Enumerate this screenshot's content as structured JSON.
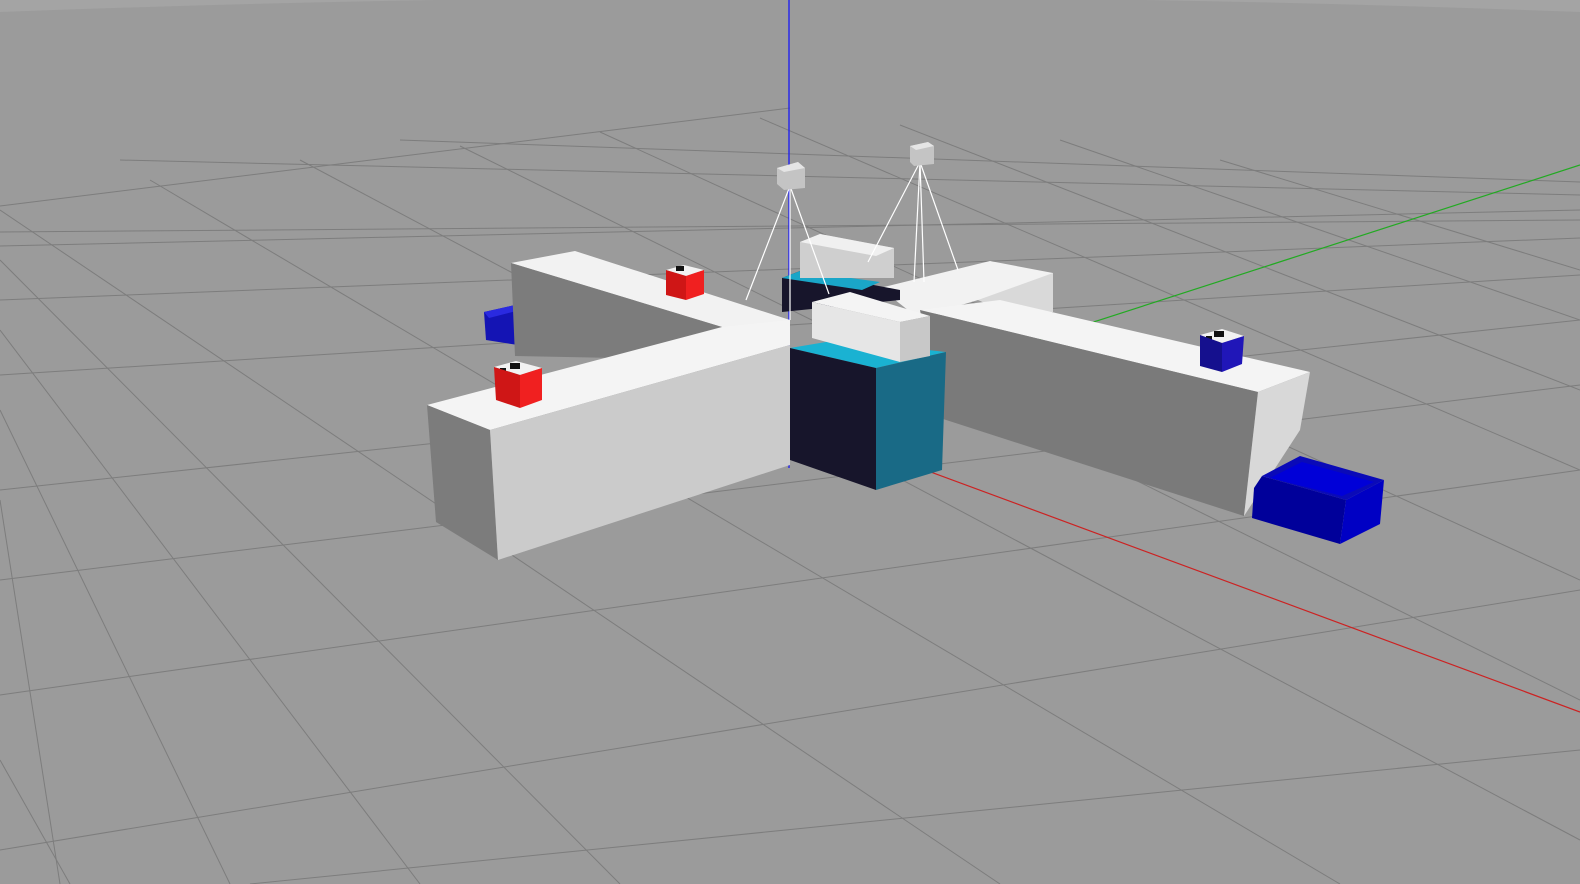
{
  "scene": {
    "background_color": "#9b9b9b",
    "grid_color": "#7f7f7f",
    "axis_colors": {
      "x": "#cc2222",
      "y": "#22aa22",
      "z": "#2222ee"
    },
    "objects": [
      {
        "name": "conveyor-left-arm",
        "color": "#e6e6e6"
      },
      {
        "name": "conveyor-right-arm",
        "color": "#e6e6e6"
      },
      {
        "name": "center-robot-base",
        "color": "#17152b",
        "accent": "#1aa6c8"
      },
      {
        "name": "red-cube",
        "color": "#dd1c1c",
        "count": 2
      },
      {
        "name": "blue-cube",
        "color": "#1a10a8",
        "count": 1
      },
      {
        "name": "blue-bin",
        "color": "#0a0ac8",
        "count": 2
      },
      {
        "name": "overhead-camera",
        "color": "#cfcfcf",
        "count": 2
      }
    ]
  }
}
